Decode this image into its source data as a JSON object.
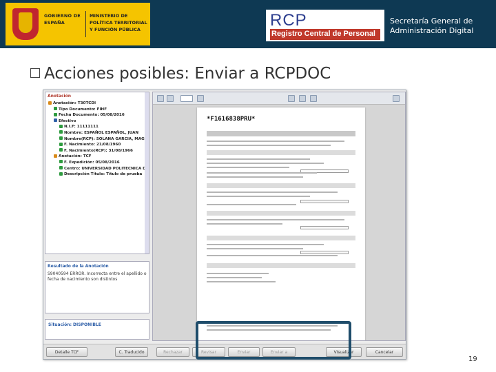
{
  "header": {
    "gob_left": "GOBIERNO DE ESPAÑA",
    "gob_right": "MINISTERIO DE POLÍTICA TERRITORIAL Y FUNCIÓN PÚBLICA",
    "rcp_logo": "RCP",
    "rcp_subtitle": "Registro Central de Personal",
    "secretaria": "Secretaría General de Administración Digital"
  },
  "title": "Acciones posibles: Enviar a RCPDOC",
  "tree": {
    "heading": "Anotación",
    "rows": [
      {
        "label": "Anotación: T30TCDI",
        "icon": "o"
      },
      {
        "label": "Tipo Documento: FIHF",
        "icon": "g"
      },
      {
        "label": "Fecha Documento: 05/08/2016",
        "icon": "g"
      },
      {
        "label": "Efectivo",
        "icon": "b"
      },
      {
        "label": "N.I.F: 11111111",
        "icon": "g"
      },
      {
        "label": "Nombre: ESPAÑOL ESPAÑOL, JUAN",
        "icon": "g"
      },
      {
        "label": "Nombre(RCP): SOLANA GARCIA, MAGDAL",
        "icon": "g"
      },
      {
        "label": "F. Nacimiento: 21/08/1960",
        "icon": "g"
      },
      {
        "label": "F. Nacimiento(RCP): 31/08/1966",
        "icon": "g"
      },
      {
        "label": "Anotación: TCF",
        "icon": "o"
      },
      {
        "label": "F. Expedición: 05/08/2016",
        "icon": "g"
      },
      {
        "label": "Centro: UNIVERSIDAD POLITECNICA DE MAI",
        "icon": "g"
      },
      {
        "label": "Descripción Título: Título de prueba",
        "icon": "g"
      }
    ]
  },
  "result": {
    "heading": "Resultado de la Anotación",
    "text": "S9040594 ERROR. Incorrecta entre el apellido o fecha de nacimiento son distintos"
  },
  "situacion": "Situación: DISPONIBLE",
  "doc": {
    "code": "*F1616838PRU*"
  },
  "buttons": [
    {
      "label": "Detalle TCF",
      "dim": false
    },
    {
      "label": "C. Traducido",
      "dim": false
    },
    {
      "label": "Rechazar",
      "dim": true
    },
    {
      "label": "Revisar",
      "dim": true
    },
    {
      "label": "Enviar",
      "dim": true
    },
    {
      "label": "Enviar a RCPDOC",
      "dim": true
    },
    {
      "label": "Visualizar",
      "dim": false
    },
    {
      "label": "Cancelar",
      "dim": false
    }
  ],
  "page_number": "19",
  "colors": {
    "header_bg": "#0e3953",
    "gob_yellow": "#f5c400",
    "rcp_red": "#c0392b",
    "highlight": "#1f4d6b"
  }
}
